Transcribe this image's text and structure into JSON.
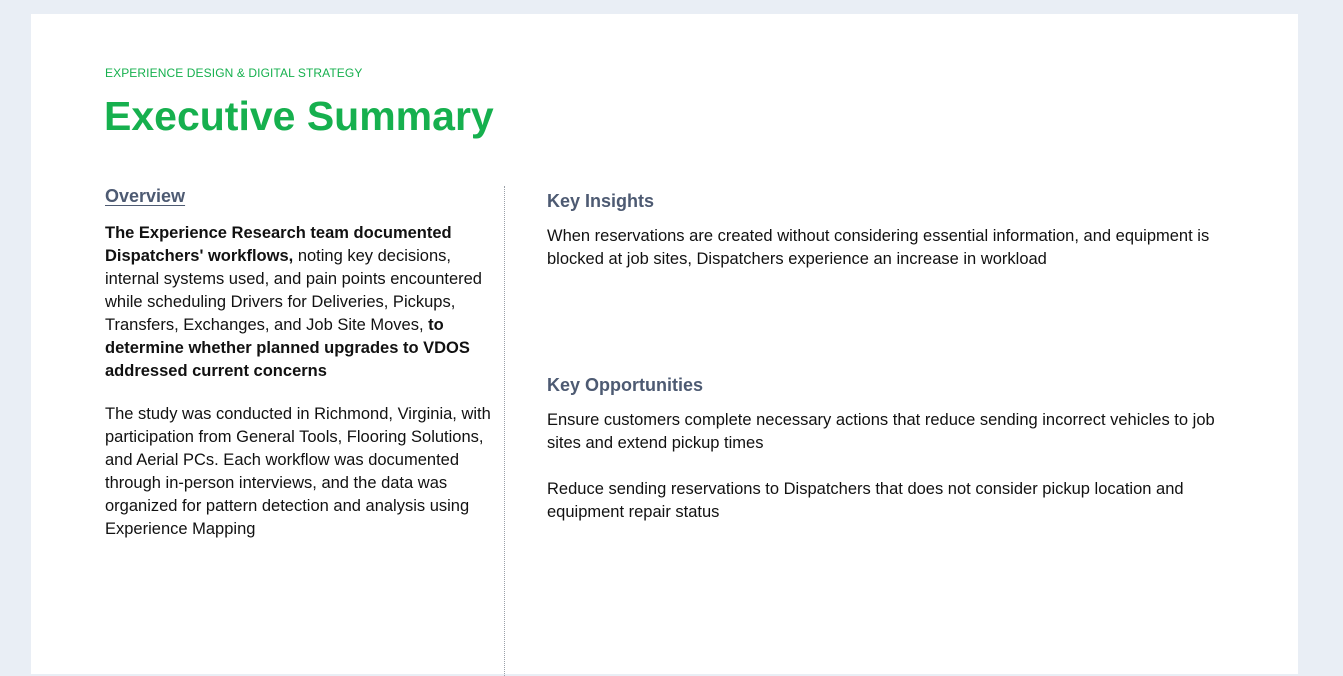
{
  "header": {
    "eyebrow": "EXPERIENCE DESIGN & DIGITAL STRATEGY",
    "title": "Executive Summary"
  },
  "overview": {
    "heading": "Overview",
    "paragraph1": {
      "bold_intro": "The Experience Research team documented Dispatchers' workflows,",
      "body": " noting key decisions, internal systems used, and pain points encountered while scheduling Drivers for Deliveries, Pickups, Transfers, Exchanges, and Job Site Moves, ",
      "bold_outro": "to determine whether planned upgrades to VDOS addressed current concerns"
    },
    "paragraph2": "The study was conducted in Richmond, Virginia, with participation from General Tools, Flooring Solutions, and Aerial PCs. Each workflow was documented through in-person interviews, and the data was organized for pattern detection and analysis using Experience Mapping"
  },
  "key_insights": {
    "heading": "Key Insights",
    "text": "When reservations are created without considering essential information, and equipment is blocked at job sites, Dispatchers experience an increase in workload"
  },
  "key_opportunities": {
    "heading": "Key Opportunities",
    "items": [
      "Ensure customers complete necessary actions that reduce sending incorrect vehicles to job sites and extend pickup times",
      "Reduce sending reservations to Dispatchers that does not consider pickup location and equipment repair status"
    ]
  },
  "colors": {
    "accent": "#16b04e",
    "heading": "#4d5a72",
    "background": "#e9eef5"
  }
}
